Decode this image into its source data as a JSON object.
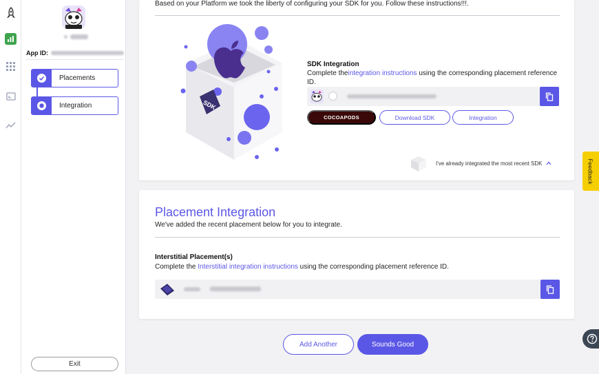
{
  "rail": {
    "icons": [
      "rocket-icon",
      "bar-chart-icon",
      "grid-icon",
      "monitor-icon",
      "trend-icon"
    ]
  },
  "sidebar": {
    "app_id_label": "App ID:",
    "steps": [
      {
        "label": "Placements",
        "state": "completed"
      },
      {
        "label": "Integration",
        "state": "current"
      }
    ],
    "exit_label": "Exit"
  },
  "sdk_card": {
    "intro": "Based on your Platform we took the liberty of configuring your SDK for you. Follow these instructions!!!.",
    "title": "SDK Integration",
    "desc_before": "Complete the",
    "desc_link": "integration instructions",
    "desc_after": " using the corresponding placement reference ID.",
    "cocoapods_label": "COCOAPODS",
    "download_label": "Download SDK",
    "integration_label": "Integration",
    "already_label": "I've already integrated the most recent SDK"
  },
  "placement_card": {
    "title": "Placement Integration",
    "subtitle": "We've added the recent placement below for you to integrate.",
    "section_title": "Interstitial Placement(s)",
    "desc_before": "Complete the ",
    "desc_link": "Interstitial integration instructions",
    "desc_after": " using the corresponding placement reference ID."
  },
  "footer": {
    "add_another_label": "Add Another",
    "sounds_good_label": "Sounds Good"
  },
  "feedback_label": "Feedback",
  "colors": {
    "accent": "#5b57e6",
    "cocoapods_bg": "#3a0808",
    "feedback_bg": "#f6cf00",
    "help_bg": "#3b4654"
  }
}
